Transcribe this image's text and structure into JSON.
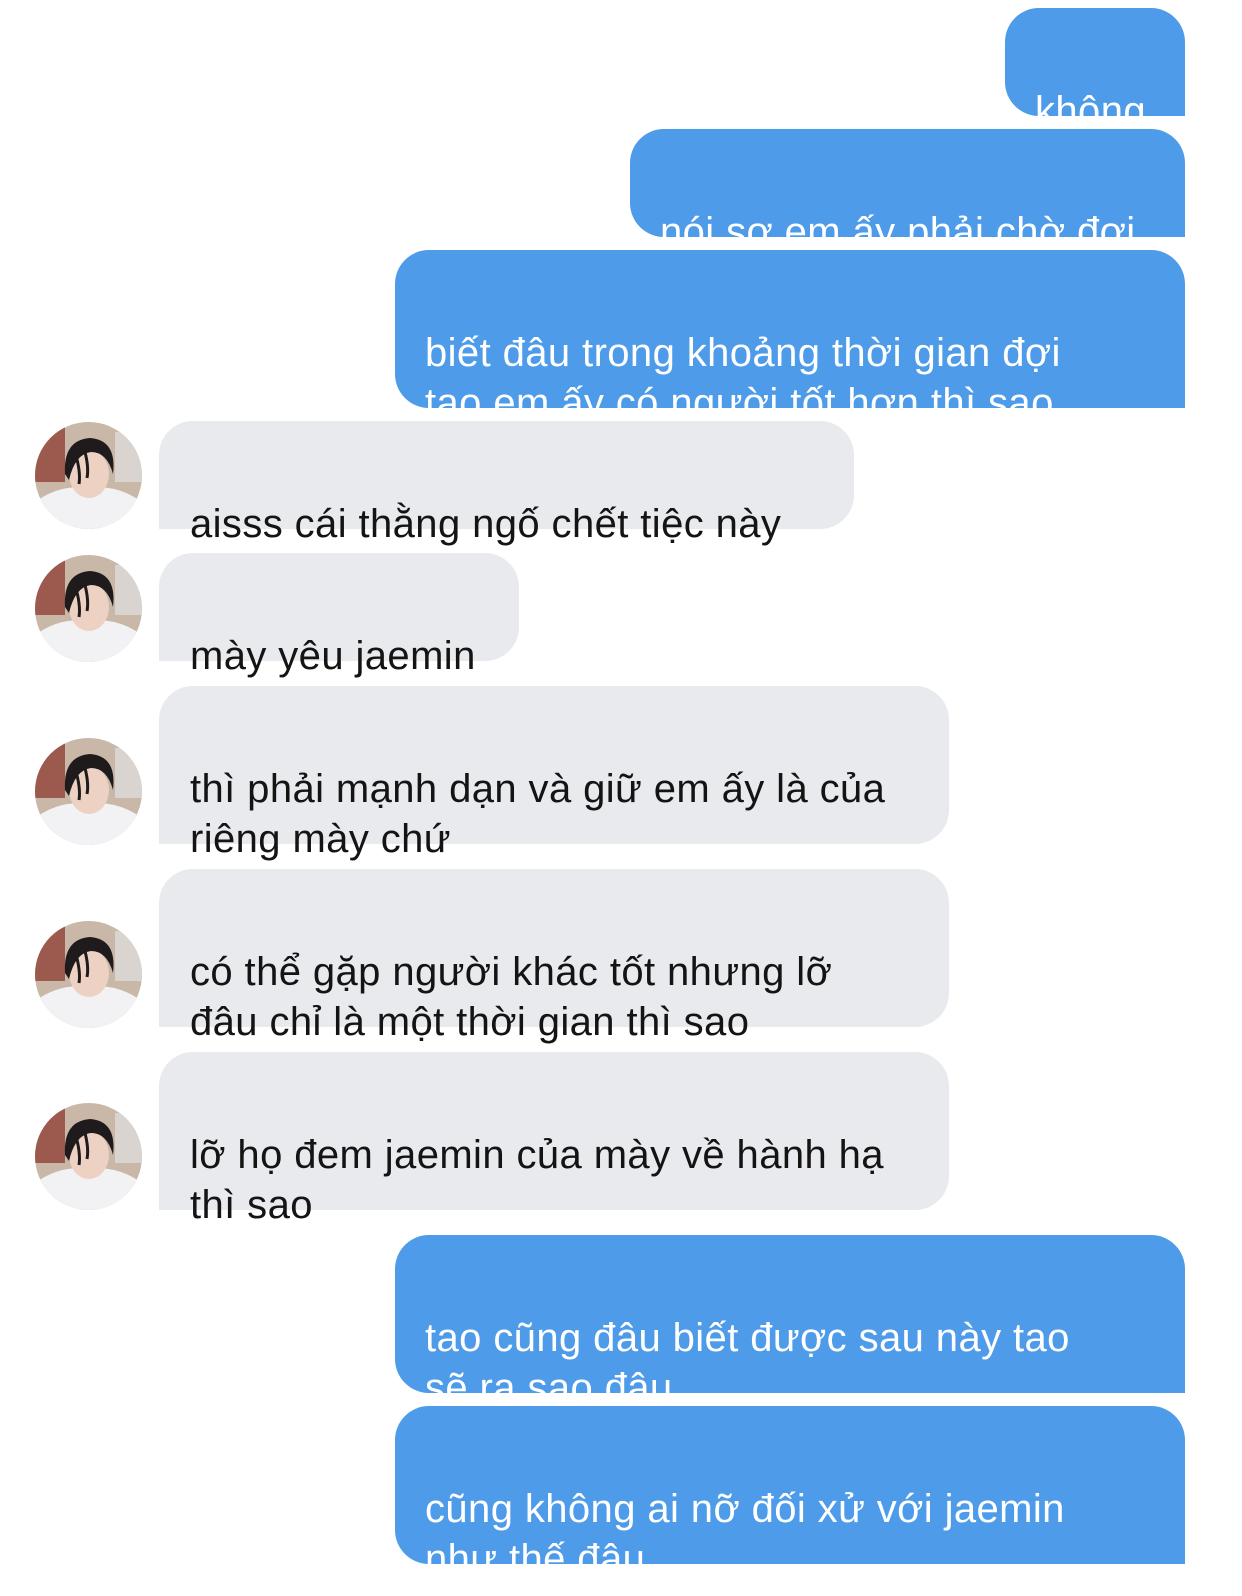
{
  "conversation": {
    "messages": [
      {
        "sender": "me",
        "text": "không"
      },
      {
        "sender": "me",
        "text": "nói sợ em ấy phải chờ đợi"
      },
      {
        "sender": "me",
        "text": "biết đâu trong khoảng thời gian đợi\ntao em ấy có người tốt hơn thì sao"
      },
      {
        "sender": "contact",
        "text": "aisss cái thằng ngố chết tiệc này"
      },
      {
        "sender": "contact",
        "text": "mày yêu jaemin"
      },
      {
        "sender": "contact",
        "text": "thì phải mạnh dạn và giữ em ấy là của\nriêng mày chứ"
      },
      {
        "sender": "contact",
        "text": "có thể gặp người khác tốt nhưng lỡ\nđâu chỉ là một thời gian thì sao"
      },
      {
        "sender": "contact",
        "text": "lỡ họ đem jaemin của mày về hành hạ\nthì sao"
      },
      {
        "sender": "me",
        "text": "tao cũng đâu biết được sau này tao\nsẽ ra sao đâu"
      },
      {
        "sender": "me",
        "text": "cũng không ai nỡ đối xử với jaemin\nnhư thế đâu"
      }
    ]
  },
  "colors": {
    "sent_bubble": "#4d9be9",
    "received_bubble": "#e9eaee",
    "background": "#ffffff"
  },
  "icons": {
    "avatar": "contact-avatar-photo"
  }
}
